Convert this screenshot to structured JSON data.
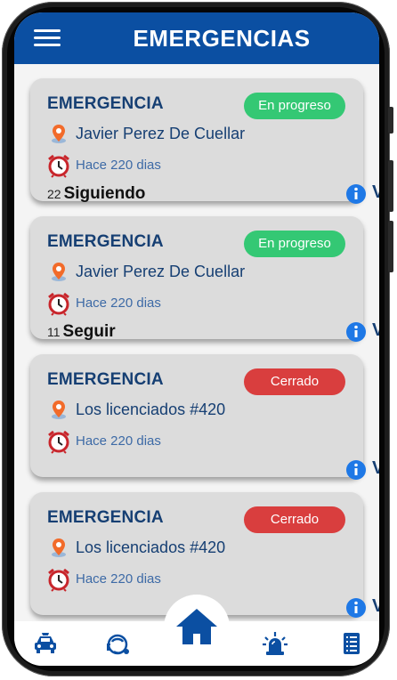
{
  "header": {
    "title": "EMERGENCIAS",
    "menu_icon": "menu-icon"
  },
  "colors": {
    "primary": "#0b4fa2",
    "in_progress": "#34c874",
    "closed": "#d93e3e",
    "card_bg": "#dcdcdc",
    "text_dark": "#163f73",
    "location_pin": "#f26b2a",
    "alarm": "#c8252b",
    "info": "#1e78e6"
  },
  "cards": [
    {
      "title": "EMERGENCIA",
      "status": "En progreso",
      "status_kind": "progress",
      "location": "Javier Perez De Cuellar",
      "time": "Hace 220 dias",
      "follow_count": "22",
      "follow_label": "Siguiendo",
      "details_label": "Ver detalles"
    },
    {
      "title": "EMERGENCIA",
      "status": "En progreso",
      "status_kind": "progress",
      "location": "Javier Perez De Cuellar",
      "time": "Hace 220 dias",
      "follow_count": "11",
      "follow_label": "Seguir",
      "details_label": "Ver detalles"
    },
    {
      "title": "EMERGENCIA",
      "status": "Cerrado",
      "status_kind": "closed",
      "location": "Los licenciados #420",
      "time": "Hace 220 dias",
      "follow_count": "",
      "follow_label": "",
      "details_label": "Ver detalles"
    },
    {
      "title": "EMERGENCIA",
      "status": "Cerrado",
      "status_kind": "closed",
      "location": "Los licenciados #420",
      "time": "Hace 220 dias",
      "follow_count": "",
      "follow_label": "",
      "details_label": "Ver detalles"
    }
  ],
  "tabbar": {
    "items": [
      "police-car-icon",
      "agent-icon",
      "home-icon",
      "siren-icon",
      "report-list-icon"
    ],
    "active": "home-icon"
  }
}
